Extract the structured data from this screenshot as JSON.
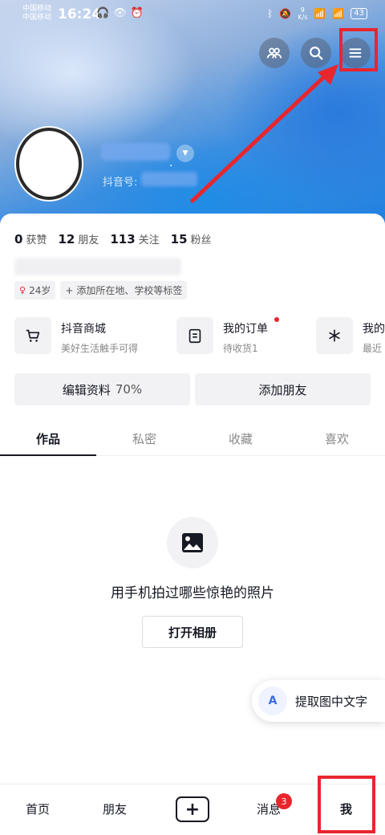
{
  "status_bar": {
    "carrier_1": "中国移动",
    "carrier_2": "中国移动",
    "time": "16:24",
    "net_speed_value": "9",
    "net_speed_unit": "K/s",
    "battery": "43"
  },
  "profile": {
    "douyin_id_label": "抖音号:",
    "stats": [
      {
        "value": "0",
        "label": "获赞"
      },
      {
        "value": "12",
        "label": "朋友"
      },
      {
        "value": "113",
        "label": "关注"
      },
      {
        "value": "15",
        "label": "粉丝"
      }
    ],
    "tags": {
      "age": "24岁",
      "add_tag": "添加所在地、学校等标签"
    }
  },
  "services": [
    {
      "title": "抖音商城",
      "subtitle": "美好生活触手可得"
    },
    {
      "title": "我的订单",
      "subtitle": "待收货1"
    },
    {
      "title": "我的",
      "subtitle": "最近"
    }
  ],
  "actions": {
    "edit_profile": "编辑资料",
    "edit_percent": "70%",
    "add_friend": "添加朋友"
  },
  "tabs": [
    "作品",
    "私密",
    "收藏",
    "喜欢"
  ],
  "empty_state": {
    "text": "用手机拍过哪些惊艳的照片",
    "button": "打开相册"
  },
  "ocr_float": {
    "icon_letter": "A",
    "label": "提取图中文字"
  },
  "bottom_nav": {
    "home": "首页",
    "friends": "朋友",
    "plus": "+",
    "messages": "消息",
    "messages_badge": "3",
    "me": "我"
  },
  "colors": {
    "highlight": "#e8262e",
    "text_primary": "#161823",
    "banner_accent": "#1d7fe0"
  }
}
